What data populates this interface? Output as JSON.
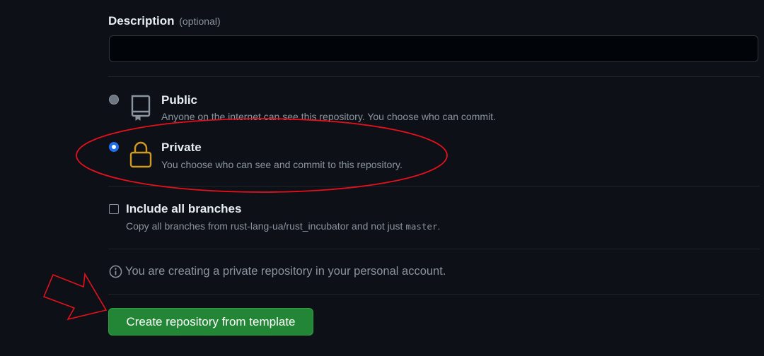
{
  "description": {
    "label": "Description",
    "optional": "(optional)",
    "value": "",
    "placeholder": ""
  },
  "visibility": {
    "selected": "private",
    "options": [
      {
        "id": "public",
        "title": "Public",
        "description": "Anyone on the internet can see this repository. You choose who can commit.",
        "icon": "repo-book-icon"
      },
      {
        "id": "private",
        "title": "Private",
        "description": "You choose who can see and commit to this repository.",
        "icon": "lock-icon"
      }
    ]
  },
  "include_branches": {
    "label": "Include all branches",
    "checked": false,
    "desc_prefix": "Copy all branches from rust-lang-ua/rust_incubator and not just ",
    "branch": "master",
    "desc_suffix": "."
  },
  "info": {
    "icon": "info-icon",
    "text": "You are creating a private repository in your personal account."
  },
  "create_button": {
    "label": "Create repository from template"
  },
  "colors": {
    "background": "#0d1117",
    "button": "#238636",
    "accent": "#1f6feb",
    "lock": "#d29922",
    "annotation": "#e5101b"
  }
}
